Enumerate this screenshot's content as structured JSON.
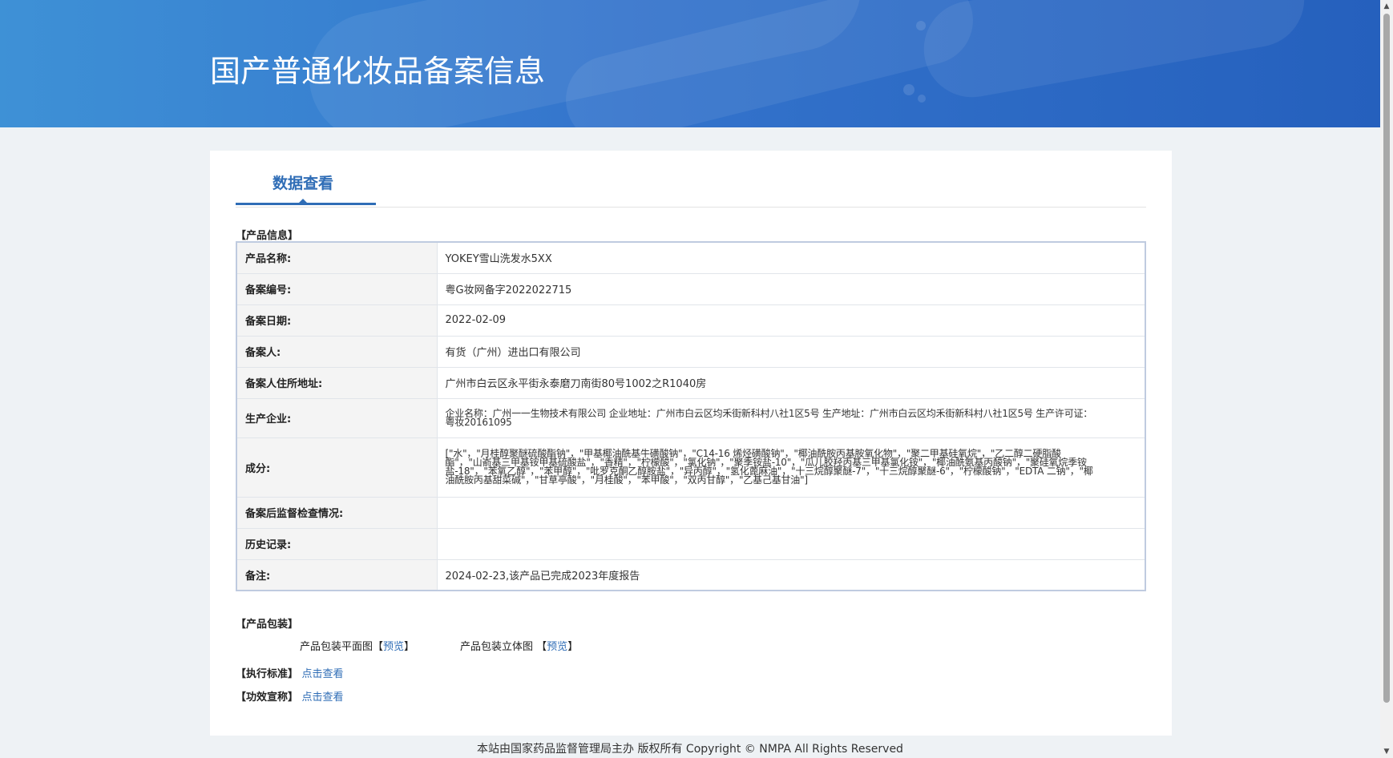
{
  "header": {
    "title": "国产普通化妆品备案信息"
  },
  "tab": {
    "label": "数据查看"
  },
  "product_info": {
    "section_label": "【产品信息】",
    "rows": [
      {
        "label": "产品名称:",
        "value": "YOKEY雪山洗发水5XX"
      },
      {
        "label": "备案编号:",
        "value": "粤G妆网备字2022022715"
      },
      {
        "label": "备案日期:",
        "value": "2022-02-09"
      },
      {
        "label": "备案人:",
        "value": "有货（广州）进出口有限公司"
      },
      {
        "label": "备案人住所地址:",
        "value": "广州市白云区永平街永泰磨刀南街80号1002之R1040房"
      },
      {
        "label": "生产企业:",
        "value": "企业名称：广州一一生物技术有限公司 企业地址：广州市白云区均禾街新科村八社1区5号 生产地址：广州市白云区均禾街新科村八社1区5号 生产许可证：粤妆20161095"
      },
      {
        "label": "成分:",
        "value": "[\"水\"，\"月桂醇聚醚硫酸酯钠\"，\"甲基椰油酰基牛磺酸钠\"，\"C14-16 烯烃磺酸钠\"，\"椰油酰胺丙基胺氧化物\"，\"聚二甲基硅氧烷\"，\"乙二醇二硬脂酸酯\"，\"山嵛基三甲基铵甲基硫酸盐\"，\"香精\"，\"柠檬酸\"，\"氯化钠\"，\"聚季铵盐-10\"，\"瓜儿胶羟丙基三甲基氯化铵\"，\"椰油酰氨基丙酸钠\"，\"聚硅氧烷季铵盐-18\"，\"苯氧乙醇\"，\"苯甲醇\"，\"吡罗克酮乙醇胺盐\"，\"异丙醇\"，\"氢化蓖麻油\"，\"十三烷醇聚醚-7\"，\"十三烷醇聚醚-6\"，\"柠檬酸钠\"，\"EDTA 二钠\"，\"椰油酰胺丙基甜菜碱\"，\"甘草亭酸\"，\"月桂酸\"，\"苯甲酸\"，\"双丙甘醇\"，\"乙基己基甘油\"]"
      },
      {
        "label": "备案后监督检查情况:",
        "value": ""
      },
      {
        "label": "历史记录:",
        "value": ""
      },
      {
        "label": "备注:",
        "value": "2024-02-23,该产品已完成2023年度报告"
      }
    ]
  },
  "packaging": {
    "section_label": "【产品包装】",
    "flat_label": "产品包装平面图",
    "solid_label": "产品包装立体图",
    "bracket_open": "【",
    "bracket_close": "】",
    "preview_link": "预览"
  },
  "standard": {
    "section_label": "【执行标准】",
    "link": "点击查看"
  },
  "efficacy": {
    "section_label": "【功效宣称】",
    "link": "点击查看"
  },
  "footer": {
    "text": "本站由国家药品监督管理局主办 版权所有 Copyright © NMPA All Rights Reserved"
  }
}
